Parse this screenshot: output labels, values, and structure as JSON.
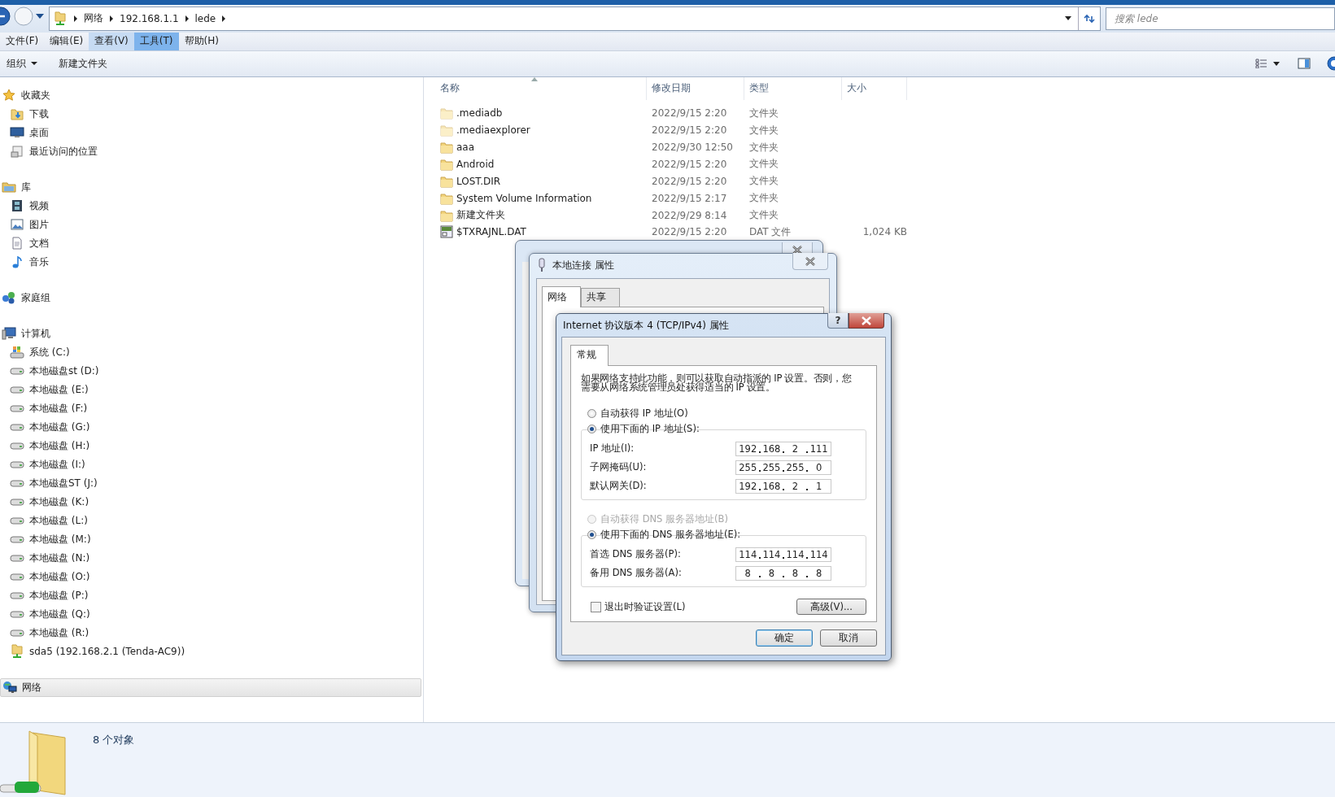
{
  "address_bar": {
    "path": [
      "网络",
      "192.168.1.1",
      "lede"
    ]
  },
  "search": {
    "placeholder": "搜索 lede"
  },
  "menu": [
    {
      "label": "文件(F)",
      "selected": false,
      "hovered": false
    },
    {
      "label": "编辑(E)",
      "selected": false,
      "hovered": false
    },
    {
      "label": "查看(V)",
      "selected": false,
      "hovered": true
    },
    {
      "label": "工具(T)",
      "selected": true,
      "hovered": false
    },
    {
      "label": "帮助(H)",
      "selected": false,
      "hovered": false
    }
  ],
  "toolbar": [
    {
      "label": "组织",
      "dropdown": true
    },
    {
      "label": "新建文件夹",
      "dropdown": false
    }
  ],
  "sidebar": {
    "groups": [
      {
        "label": "收藏夹",
        "kind": "favorites",
        "selected": false,
        "children": [
          {
            "label": "下载",
            "kind": "downloads",
            "selected": false
          },
          {
            "label": "桌面",
            "kind": "desktop",
            "selected": false
          },
          {
            "label": "最近访问的位置",
            "kind": "recent",
            "selected": false
          }
        ]
      },
      {
        "label": "库",
        "kind": "libraries",
        "selected": false,
        "children": [
          {
            "label": "视频",
            "kind": "videos",
            "selected": false
          },
          {
            "label": "图片",
            "kind": "pictures",
            "selected": false
          },
          {
            "label": "文档",
            "kind": "documents",
            "selected": false
          },
          {
            "label": "音乐",
            "kind": "music",
            "selected": false
          }
        ]
      },
      {
        "label": "家庭组",
        "kind": "homegroup",
        "selected": false
      },
      {
        "label": "计算机",
        "kind": "computer",
        "selected": false,
        "children": [
          {
            "label": "系统 (C:)",
            "kind": "system_drive",
            "selected": false
          },
          {
            "label": "本地磁盘st (D:)",
            "kind": "drive",
            "selected": false
          },
          {
            "label": "本地磁盘 (E:)",
            "kind": "drive",
            "selected": false
          },
          {
            "label": "本地磁盘 (F:)",
            "kind": "drive",
            "selected": false
          },
          {
            "label": "本地磁盘 (G:)",
            "kind": "drive",
            "selected": false
          },
          {
            "label": "本地磁盘 (H:)",
            "kind": "drive",
            "selected": false
          },
          {
            "label": "本地磁盘 (I:)",
            "kind": "drive",
            "selected": false
          },
          {
            "label": "本地磁盘ST (J:)",
            "kind": "drive",
            "selected": false
          },
          {
            "label": "本地磁盘 (K:)",
            "kind": "drive",
            "selected": false
          },
          {
            "label": "本地磁盘 (L:)",
            "kind": "drive",
            "selected": false
          },
          {
            "label": "本地磁盘 (M:)",
            "kind": "drive",
            "selected": false
          },
          {
            "label": "本地磁盘 (N:)",
            "kind": "drive",
            "selected": false
          },
          {
            "label": "本地磁盘 (O:)",
            "kind": "drive",
            "selected": false
          },
          {
            "label": "本地磁盘 (P:)",
            "kind": "drive",
            "selected": false
          },
          {
            "label": "本地磁盘 (Q:)",
            "kind": "drive",
            "selected": false
          },
          {
            "label": "本地磁盘 (R:)",
            "kind": "drive",
            "selected": false
          },
          {
            "label": "sda5 (192.168.2.1 (Tenda-AC9))",
            "kind": "network_drive",
            "selected": false
          }
        ]
      },
      {
        "label": "网络",
        "kind": "network",
        "selected": true
      }
    ]
  },
  "file_list": {
    "columns": [
      "名称",
      "修改日期",
      "类型",
      "大小"
    ],
    "rows": [
      {
        "name": ".mediadb",
        "date": "2022/9/15 2:20",
        "type": "文件夹",
        "kind": "folder",
        "hidden": true
      },
      {
        "name": ".mediaexplorer",
        "date": "2022/9/15 2:20",
        "type": "文件夹",
        "kind": "folder",
        "hidden": true
      },
      {
        "name": "aaa",
        "date": "2022/9/30 12:50",
        "type": "文件夹",
        "kind": "folder",
        "hidden": false
      },
      {
        "name": "Android",
        "date": "2022/9/15 2:20",
        "type": "文件夹",
        "kind": "folder",
        "hidden": false
      },
      {
        "name": "LOST.DIR",
        "date": "2022/9/15 2:20",
        "type": "文件夹",
        "kind": "folder",
        "hidden": false
      },
      {
        "name": "System Volume Information",
        "date": "2022/9/15 2:17",
        "type": "文件夹",
        "kind": "folder",
        "hidden": false
      },
      {
        "name": "新建文件夹",
        "date": "2022/9/29 8:14",
        "type": "文件夹",
        "kind": "folder",
        "hidden": false
      },
      {
        "name": "$TXRAJNL.DAT",
        "date": "2022/9/15 2:20",
        "type": "DAT 文件",
        "size": "1,024 KB",
        "kind": "dat",
        "hidden": false
      }
    ]
  },
  "status_bar": {
    "count": "8 个对象"
  },
  "properties_window": {
    "title": "本地连接 属性",
    "tabs": [
      {
        "label": "网络",
        "selected": true
      },
      {
        "label": "共享",
        "selected": false
      }
    ]
  },
  "ipv4_dialog": {
    "title": "Internet 协议版本 4 (TCP/IPv4) 属性",
    "help": "?",
    "tabs": [
      {
        "label": "常规",
        "selected": true
      }
    ],
    "description": "如果网络支持此功能，则可以获取自动指派的 IP 设置。否则，您需要从网络系统管理员处获得适当的 IP 设置。",
    "sections": [
      {
        "radios": [
          {
            "label": "自动获得 IP 地址(O)",
            "selected": false,
            "disabled": false
          },
          {
            "label": "使用下面的 IP 地址(S):",
            "selected": true,
            "disabled": false
          }
        ],
        "fields": [
          {
            "label": "IP 地址(I):",
            "octets": [
              "192",
              "168",
              "2",
              "111"
            ]
          },
          {
            "label": "子网掩码(U):",
            "octets": [
              "255",
              "255",
              "255",
              "0"
            ]
          },
          {
            "label": "默认网关(D):",
            "octets": [
              "192",
              "168",
              "2",
              "1"
            ]
          }
        ]
      },
      {
        "radios": [
          {
            "label": "自动获得 DNS 服务器地址(B)",
            "selected": false,
            "disabled": true
          },
          {
            "label": "使用下面的 DNS 服务器地址(E):",
            "selected": true,
            "disabled": false
          }
        ],
        "fields": [
          {
            "label": "首选 DNS 服务器(P):",
            "octets": [
              "114",
              "114",
              "114",
              "114"
            ]
          },
          {
            "label": "备用 DNS 服务器(A):",
            "octets": [
              "8",
              "8",
              "8",
              "8"
            ]
          }
        ]
      }
    ],
    "checkbox": {
      "label": "退出时验证设置(L)",
      "checked": false
    },
    "advanced_button": "高级(V)...",
    "buttons": [
      {
        "label": "确定",
        "default": true
      },
      {
        "label": "取消",
        "default": false
      }
    ]
  }
}
